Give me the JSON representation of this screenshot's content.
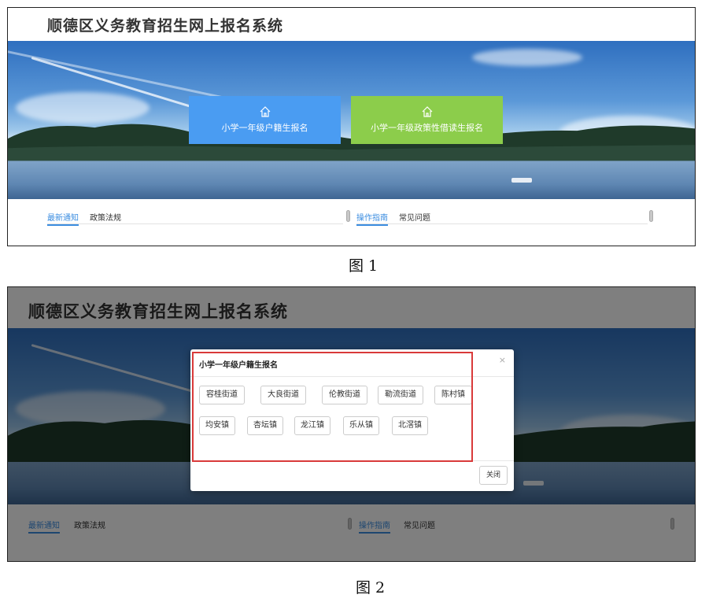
{
  "figure1": {
    "site_title": "顺德区义务教育招生网上报名系统",
    "tiles": [
      {
        "label": "小学一年级户籍生报名",
        "color": "#4a9cf2",
        "icon": "home-icon"
      },
      {
        "label": "小学一年级政策性借读生报名",
        "color": "#8ccd4b",
        "icon": "home-icon"
      }
    ],
    "news_left": {
      "tab_active": "最新通知",
      "tab_other": "政策法规"
    },
    "news_right": {
      "tab_active": "操作指南",
      "tab_other": "常见问题"
    },
    "caption": "图 1"
  },
  "figure2": {
    "site_title": "顺德区义务教育招生网上报名系统",
    "modal": {
      "title": "小学一年级户籍生报名",
      "close_x": "×",
      "options": [
        "容桂街道",
        "大良街道",
        "伦教街道",
        "勒流街道",
        "陈村镇",
        "均安镇",
        "杏坛镇",
        "龙江镇",
        "乐从镇",
        "北滘镇"
      ],
      "close_label": "关闭"
    },
    "news_left": {
      "tab_active": "最新通知",
      "tab_other": "政策法规"
    },
    "news_right": {
      "tab_active": "操作指南",
      "tab_other": "常见问题"
    },
    "caption": "图 2"
  },
  "colors": {
    "accent_blue": "#3b8de0",
    "highlight_red": "#d93a3a"
  }
}
